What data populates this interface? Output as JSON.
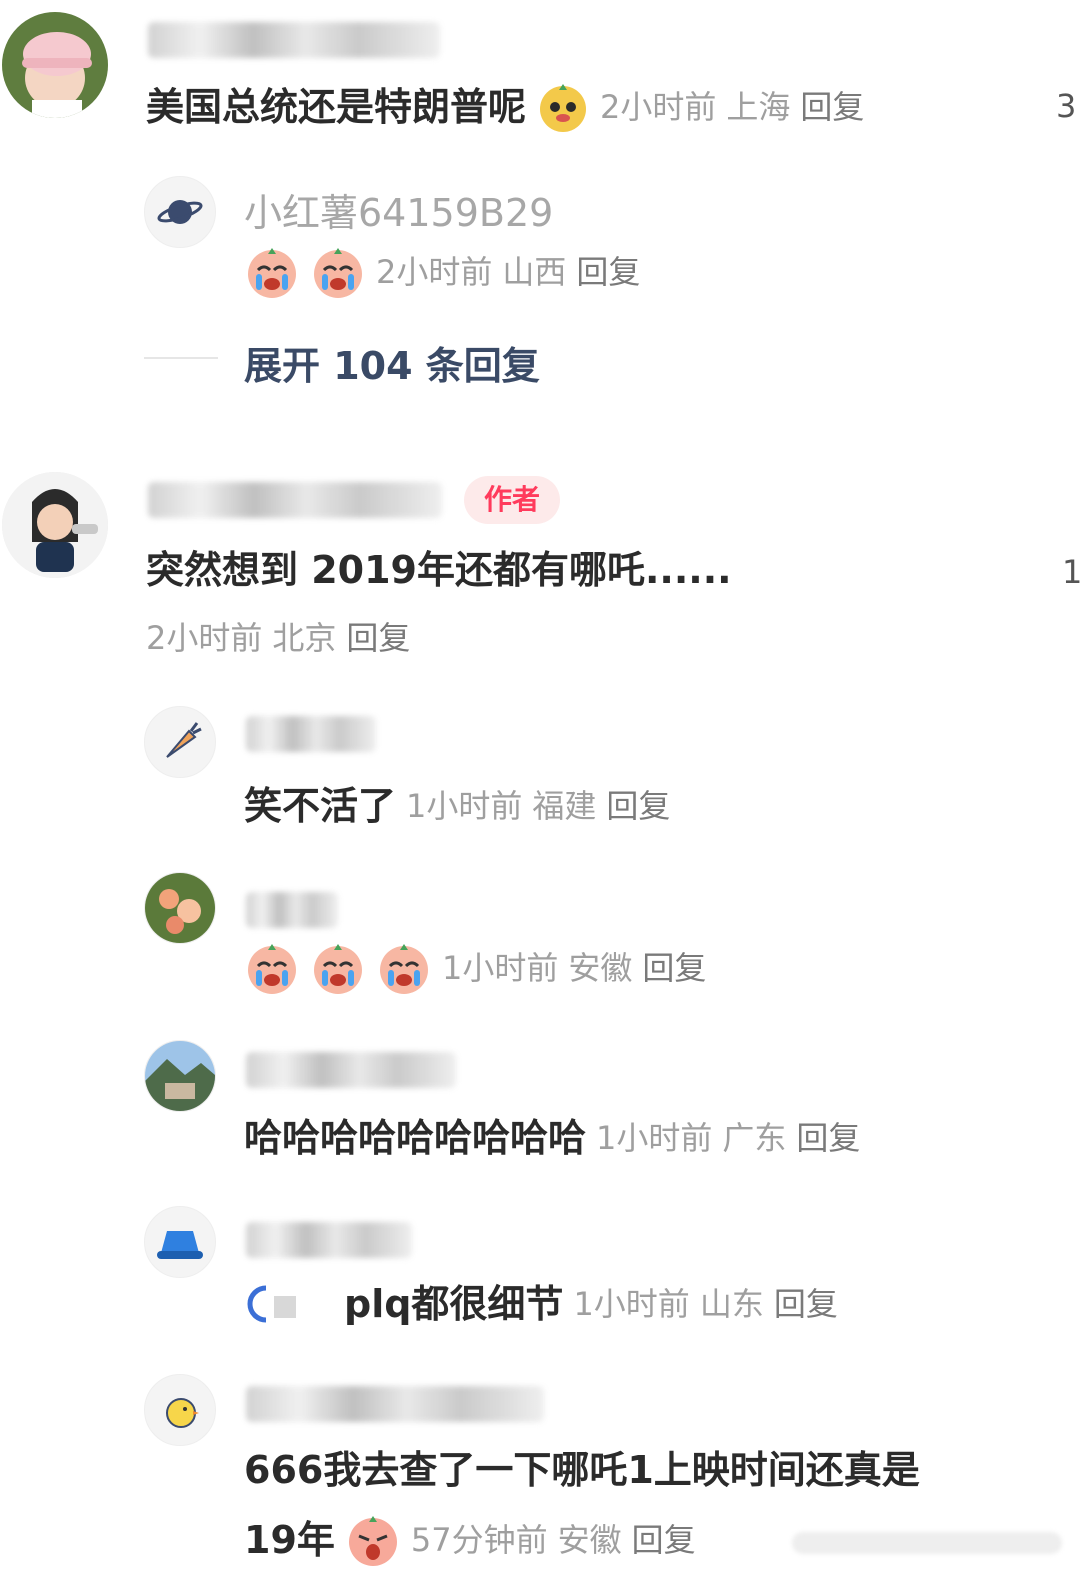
{
  "threads": [
    {
      "comment": "美国总统还是特朗普呢",
      "emoji": "slightly-smiling-face",
      "time": "2小时前",
      "location": "上海",
      "reply_label": "回复",
      "like_count_partial": "3",
      "replies": [
        {
          "username": "小红薯64159B29",
          "emoji_count": "2",
          "time": "2小时前",
          "location": "山西",
          "reply_label": "回复"
        }
      ],
      "expand_label": "展开 104 条回复"
    },
    {
      "author_badge": "作者",
      "comment": "突然想到 2019年还都有哪吒......",
      "time": "2小时前",
      "location": "北京",
      "reply_label": "回复",
      "like_count_partial": "1",
      "replies": [
        {
          "comment": "笑不活了",
          "time": "1小时前",
          "location": "福建",
          "reply_label": "回复"
        },
        {
          "time": "1小时前",
          "location": "安徽",
          "reply_label": "回复"
        },
        {
          "comment": "哈哈哈哈哈哈哈哈哈",
          "time": "1小时前",
          "location": "广东",
          "reply_label": "回复"
        },
        {
          "comment": "plq都很细节",
          "time": "1小时前",
          "location": "山东",
          "reply_label": "回复"
        },
        {
          "comment_line1": "666我去查了一下哪吒1上映时间还真是",
          "comment_line2": "19年",
          "time": "57分钟前",
          "location": "安徽",
          "reply_label": "回复"
        }
      ]
    }
  ],
  "colors": {
    "author_badge_bg": "#fdeaea",
    "author_badge_text": "#ff3b5c",
    "expand_text": "#3a4a66",
    "meta_text": "#9f9f9f"
  }
}
